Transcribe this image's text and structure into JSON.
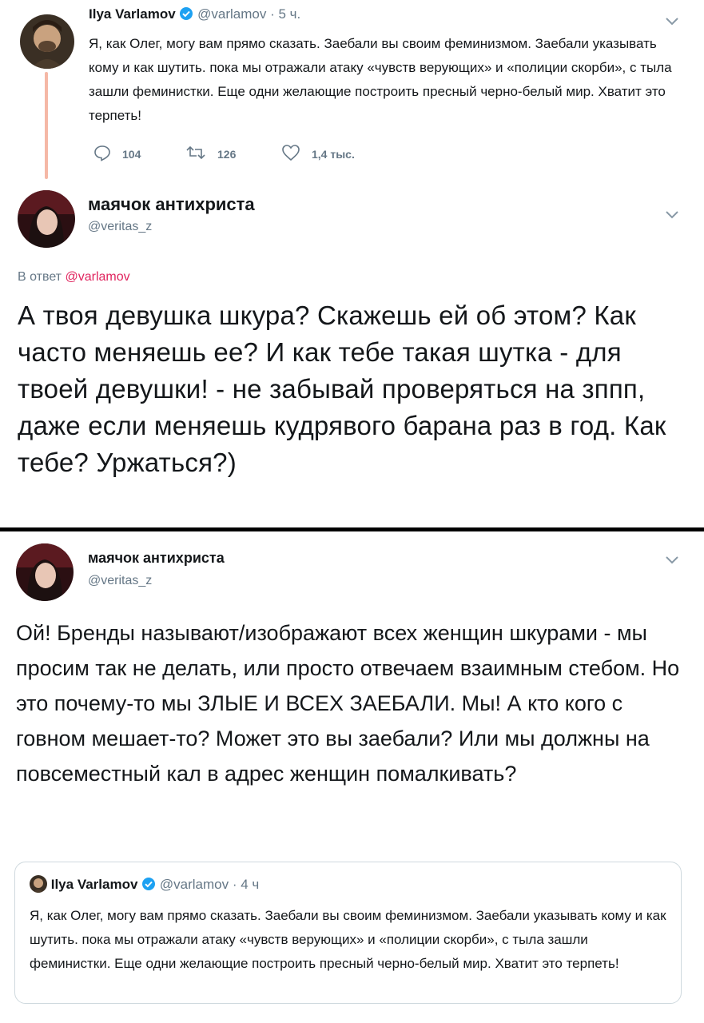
{
  "top_tweet": {
    "author_name": "Ilya Varlamov",
    "handle": "@varlamov",
    "time": "· 5 ч.",
    "text": "Я, как Олег, могу вам прямо сказать. Заебали вы своим феминизмом. Заебали указывать кому и как шутить. пока мы отражали атаку «чувств верующих» и «полиции скорби», с тыла зашли феминистки. Еще одни желающие построить пресный черно-белый мир. Хватит это терпеть!",
    "actions": {
      "replies": "104",
      "retweets": "126",
      "likes": "1,4 тыс."
    },
    "icons": {
      "reply": "comment-icon",
      "retweet": "retweet-icon",
      "like": "heart-icon",
      "verified": "verified-badge-icon",
      "menu": "chevron-down-icon"
    }
  },
  "reply_tweet": {
    "author_name": "маячок антихриста",
    "handle": "@veritas_z",
    "reply_prefix": "В ответ",
    "reply_to": "@varlamov",
    "text": "А  твоя девушка шкура? Скажешь ей об этом? Как часто меняешь ее? И как тебе такая шутка - для твоей девушки! - не забывай проверяться на зппп, даже если меняешь кудрявого барана раз в год. Как тебе? Уржаться?)"
  },
  "quote_tweet": {
    "author_name": "маячок антихриста",
    "handle": "@veritas_z",
    "text": "Ой! Бренды называют/изображают  всех женщин шкурами - мы просим так не делать, или просто отвечаем взаимным стебом. Но это почему-то мы ЗЛЫЕ И ВСЕХ ЗАЕБАЛИ. Мы! А кто кого с говном мешает-то? Может это вы заебали? Или мы должны на повсеместный кал в адрес женщин помалкивать?",
    "quoted": {
      "author_name": "Ilya Varlamov",
      "handle": "@varlamov",
      "time": "· 4 ч",
      "text": "Я, как Олег, могу вам прямо сказать. Заебали вы своим феминизмом. Заебали указывать кому и как шутить. пока мы отражали атаку «чувств верующих» и «полиции скорби», с тыла зашли феминистки. Еще одни желающие построить пресный черно-белый мир. Хватит это терпеть!"
    }
  },
  "colors": {
    "accent": "#1da1f2",
    "reply_link": "#e0245e",
    "muted": "#657786",
    "thread_line": "#f5b8a6",
    "divider": "#000000"
  }
}
